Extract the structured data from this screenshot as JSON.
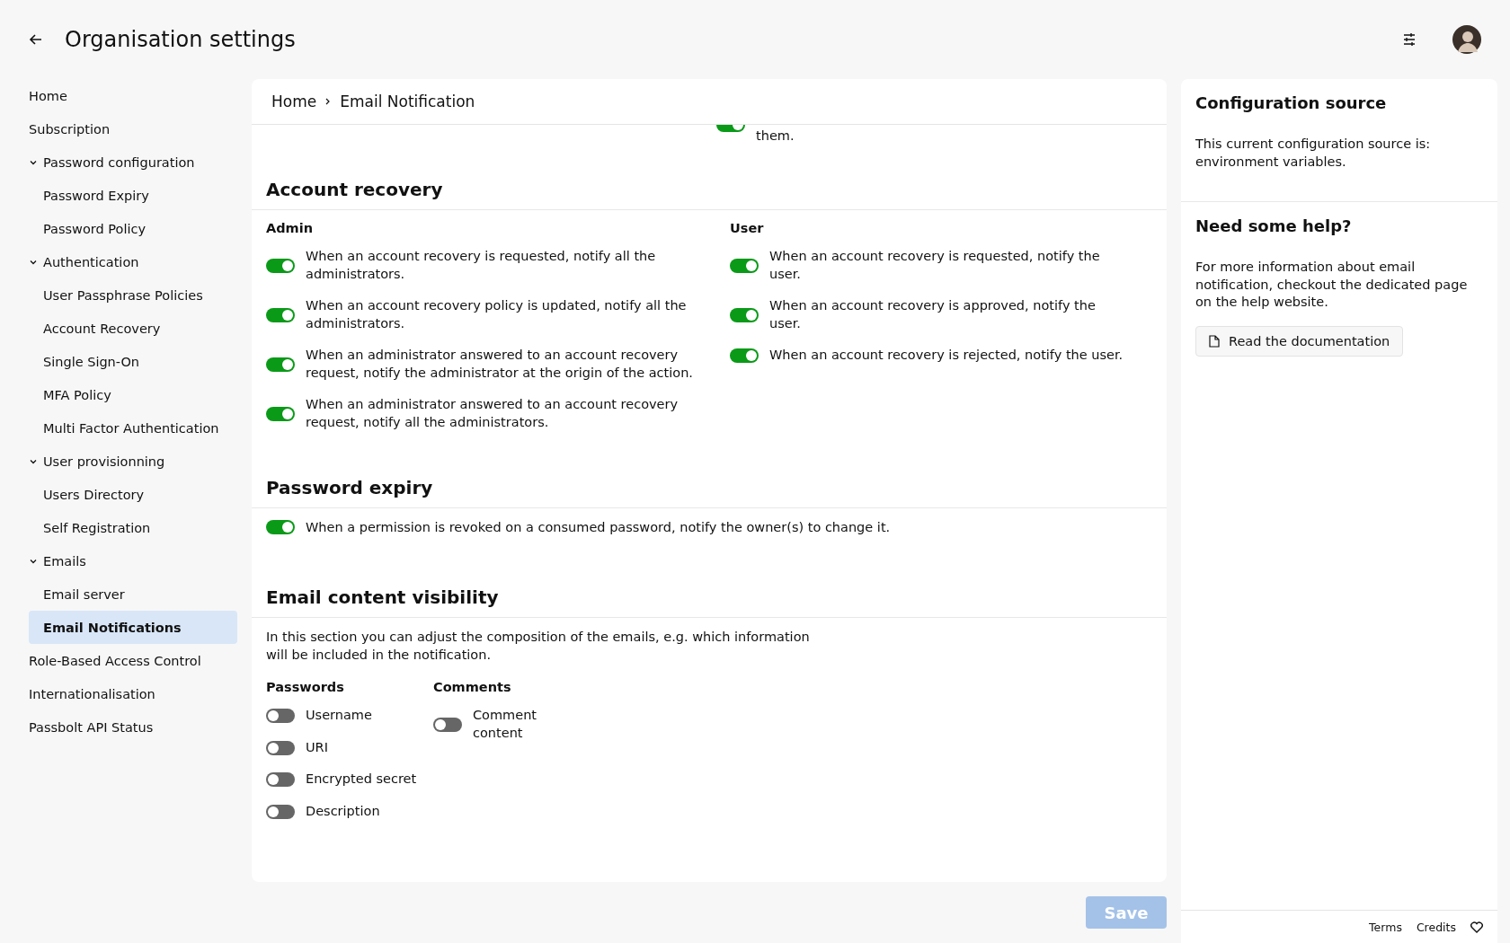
{
  "header": {
    "title": "Organisation settings"
  },
  "sidebar": {
    "items": [
      {
        "label": "Home",
        "selected": false
      },
      {
        "label": "Subscription",
        "selected": false
      },
      {
        "label": "Password configuration",
        "selected": false,
        "expanded": true,
        "children": [
          {
            "label": "Password Expiry",
            "selected": false
          },
          {
            "label": "Password Policy",
            "selected": false
          }
        ]
      },
      {
        "label": "Authentication",
        "selected": false,
        "expanded": true,
        "children": [
          {
            "label": "User Passphrase Policies",
            "selected": false
          },
          {
            "label": "Account Recovery",
            "selected": false
          },
          {
            "label": "Single Sign-On",
            "selected": false
          },
          {
            "label": "MFA Policy",
            "selected": false
          },
          {
            "label": "Multi Factor Authentication",
            "selected": false
          }
        ]
      },
      {
        "label": "User provisionning",
        "selected": false,
        "expanded": true,
        "children": [
          {
            "label": "Users Directory",
            "selected": false
          },
          {
            "label": "Self Registration",
            "selected": false
          }
        ]
      },
      {
        "label": "Emails",
        "selected": false,
        "expanded": true,
        "children": [
          {
            "label": "Email server",
            "selected": false
          },
          {
            "label": "Email Notifications",
            "selected": true
          }
        ]
      },
      {
        "label": "Role-Based Access Control",
        "selected": false
      },
      {
        "label": "Internationalisation",
        "selected": false
      },
      {
        "label": "Passbolt API Status",
        "selected": false
      }
    ]
  },
  "breadcrumb": [
    "Home",
    "Email Notification"
  ],
  "scrolled_fragment": {
    "text": "them.",
    "on": true
  },
  "sections": [
    {
      "title": "Account recovery",
      "kind": "wide",
      "columns": [
        {
          "title": "Admin",
          "toggles": [
            {
              "label": "When an account recovery is requested, notify all the administrators.",
              "on": true
            },
            {
              "label": "When an account recovery policy is updated, notify all the administrators.",
              "on": true
            },
            {
              "label": "When an administrator answered to an account recovery request, notify the administrator at the origin of the action.",
              "on": true
            },
            {
              "label": "When an administrator answered to an account recovery request, notify all the administrators.",
              "on": true
            }
          ]
        },
        {
          "title": "User",
          "toggles": [
            {
              "label": "When an account recovery is requested, notify the user.",
              "on": true
            },
            {
              "label": "When an account recovery is approved, notify the user.",
              "on": true
            },
            {
              "label": "When an account recovery is rejected, notify the user.",
              "on": true
            }
          ]
        }
      ]
    },
    {
      "title": "Password expiry",
      "kind": "single",
      "columns": [
        {
          "toggles": [
            {
              "label": "When a permission is revoked on a consumed password, notify the owner(s) to change it.",
              "on": true
            }
          ]
        }
      ]
    },
    {
      "title": "Email content visibility",
      "kind": "compact",
      "intro": "In this section you can adjust the composition of the emails, e.g. which information will be included in the notification.",
      "columns": [
        {
          "title": "Passwords",
          "toggles": [
            {
              "label": "Username",
              "on": false
            },
            {
              "label": "URI",
              "on": false
            },
            {
              "label": "Encrypted secret",
              "on": false
            },
            {
              "label": "Description",
              "on": false
            }
          ]
        },
        {
          "title": "Comments",
          "toggles": [
            {
              "label": "Comment content",
              "on": false
            }
          ]
        }
      ]
    }
  ],
  "save_button": {
    "label": "Save",
    "disabled": true
  },
  "config_source": {
    "title": "Configuration source",
    "text": "This current configuration source is: environment variables."
  },
  "help": {
    "title": "Need some help?",
    "text": "For more information about email notification, checkout the dedicated page on the help website.",
    "link": "Read the documentation"
  },
  "footer": {
    "links": [
      "Terms",
      "Credits"
    ]
  }
}
